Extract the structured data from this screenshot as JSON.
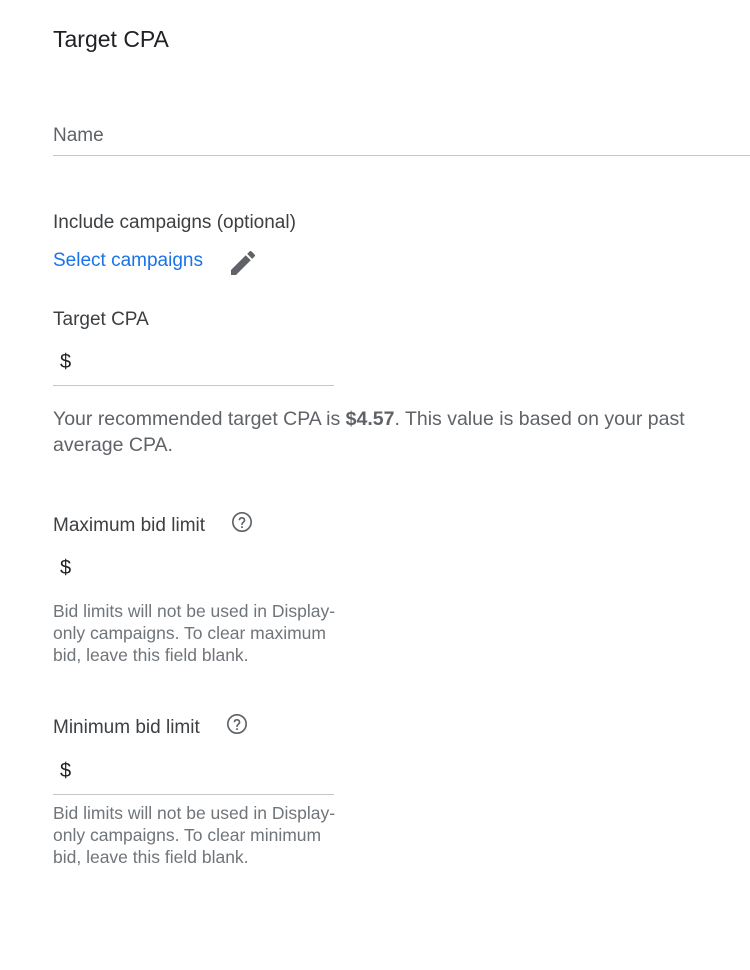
{
  "form": {
    "title": "Target CPA",
    "name_field": {
      "placeholder": "Name",
      "value": ""
    },
    "include_campaigns": {
      "label": "Include campaigns (optional)",
      "link": "Select campaigns",
      "edit_icon": "pencil-icon"
    },
    "target_cpa": {
      "label": "Target CPA",
      "currency": "$",
      "value": ""
    },
    "recommendation": {
      "prefix": "Your recommended target CPA is ",
      "amount": "$4.57",
      "suffix": ". This value is based on your past average CPA."
    },
    "max_bid": {
      "label": "Maximum bid limit",
      "help_icon": "help-circle-icon",
      "currency": "$",
      "value": "",
      "hint": "Bid limits will not be used in Display-only campaigns. To clear maximum bid, leave this field blank."
    },
    "min_bid": {
      "label": "Minimum bid limit",
      "help_icon": "help-circle-icon",
      "currency": "$",
      "value": "",
      "hint": "Bid limits will not be used in Display-only campaigns. To clear minimum bid, leave this field blank."
    }
  },
  "colors": {
    "link": "#1a73e8",
    "text": "#202124",
    "secondary_text": "#5f6368",
    "divider": "#c4c7cc"
  }
}
